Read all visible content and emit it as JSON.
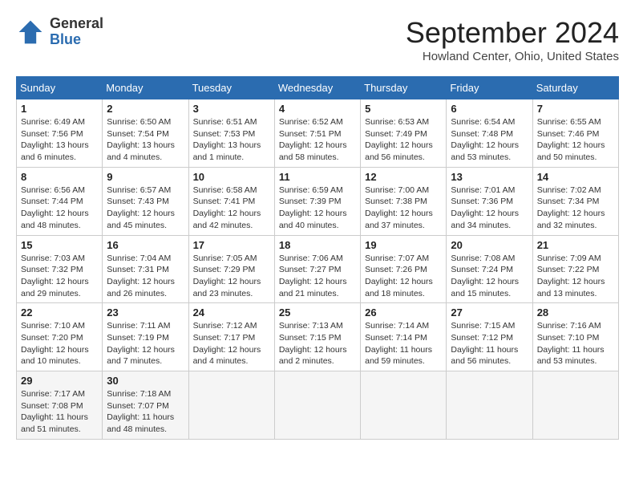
{
  "header": {
    "logo": {
      "line1": "General",
      "line2": "Blue"
    },
    "title": "September 2024",
    "location": "Howland Center, Ohio, United States"
  },
  "calendar": {
    "days_of_week": [
      "Sunday",
      "Monday",
      "Tuesday",
      "Wednesday",
      "Thursday",
      "Friday",
      "Saturday"
    ],
    "weeks": [
      [
        {
          "day": "1",
          "info": "Sunrise: 6:49 AM\nSunset: 7:56 PM\nDaylight: 13 hours\nand 6 minutes."
        },
        {
          "day": "2",
          "info": "Sunrise: 6:50 AM\nSunset: 7:54 PM\nDaylight: 13 hours\nand 4 minutes."
        },
        {
          "day": "3",
          "info": "Sunrise: 6:51 AM\nSunset: 7:53 PM\nDaylight: 13 hours\nand 1 minute."
        },
        {
          "day": "4",
          "info": "Sunrise: 6:52 AM\nSunset: 7:51 PM\nDaylight: 12 hours\nand 58 minutes."
        },
        {
          "day": "5",
          "info": "Sunrise: 6:53 AM\nSunset: 7:49 PM\nDaylight: 12 hours\nand 56 minutes."
        },
        {
          "day": "6",
          "info": "Sunrise: 6:54 AM\nSunset: 7:48 PM\nDaylight: 12 hours\nand 53 minutes."
        },
        {
          "day": "7",
          "info": "Sunrise: 6:55 AM\nSunset: 7:46 PM\nDaylight: 12 hours\nand 50 minutes."
        }
      ],
      [
        {
          "day": "8",
          "info": "Sunrise: 6:56 AM\nSunset: 7:44 PM\nDaylight: 12 hours\nand 48 minutes."
        },
        {
          "day": "9",
          "info": "Sunrise: 6:57 AM\nSunset: 7:43 PM\nDaylight: 12 hours\nand 45 minutes."
        },
        {
          "day": "10",
          "info": "Sunrise: 6:58 AM\nSunset: 7:41 PM\nDaylight: 12 hours\nand 42 minutes."
        },
        {
          "day": "11",
          "info": "Sunrise: 6:59 AM\nSunset: 7:39 PM\nDaylight: 12 hours\nand 40 minutes."
        },
        {
          "day": "12",
          "info": "Sunrise: 7:00 AM\nSunset: 7:38 PM\nDaylight: 12 hours\nand 37 minutes."
        },
        {
          "day": "13",
          "info": "Sunrise: 7:01 AM\nSunset: 7:36 PM\nDaylight: 12 hours\nand 34 minutes."
        },
        {
          "day": "14",
          "info": "Sunrise: 7:02 AM\nSunset: 7:34 PM\nDaylight: 12 hours\nand 32 minutes."
        }
      ],
      [
        {
          "day": "15",
          "info": "Sunrise: 7:03 AM\nSunset: 7:32 PM\nDaylight: 12 hours\nand 29 minutes."
        },
        {
          "day": "16",
          "info": "Sunrise: 7:04 AM\nSunset: 7:31 PM\nDaylight: 12 hours\nand 26 minutes."
        },
        {
          "day": "17",
          "info": "Sunrise: 7:05 AM\nSunset: 7:29 PM\nDaylight: 12 hours\nand 23 minutes."
        },
        {
          "day": "18",
          "info": "Sunrise: 7:06 AM\nSunset: 7:27 PM\nDaylight: 12 hours\nand 21 minutes."
        },
        {
          "day": "19",
          "info": "Sunrise: 7:07 AM\nSunset: 7:26 PM\nDaylight: 12 hours\nand 18 minutes."
        },
        {
          "day": "20",
          "info": "Sunrise: 7:08 AM\nSunset: 7:24 PM\nDaylight: 12 hours\nand 15 minutes."
        },
        {
          "day": "21",
          "info": "Sunrise: 7:09 AM\nSunset: 7:22 PM\nDaylight: 12 hours\nand 13 minutes."
        }
      ],
      [
        {
          "day": "22",
          "info": "Sunrise: 7:10 AM\nSunset: 7:20 PM\nDaylight: 12 hours\nand 10 minutes."
        },
        {
          "day": "23",
          "info": "Sunrise: 7:11 AM\nSunset: 7:19 PM\nDaylight: 12 hours\nand 7 minutes."
        },
        {
          "day": "24",
          "info": "Sunrise: 7:12 AM\nSunset: 7:17 PM\nDaylight: 12 hours\nand 4 minutes."
        },
        {
          "day": "25",
          "info": "Sunrise: 7:13 AM\nSunset: 7:15 PM\nDaylight: 12 hours\nand 2 minutes."
        },
        {
          "day": "26",
          "info": "Sunrise: 7:14 AM\nSunset: 7:14 PM\nDaylight: 11 hours\nand 59 minutes."
        },
        {
          "day": "27",
          "info": "Sunrise: 7:15 AM\nSunset: 7:12 PM\nDaylight: 11 hours\nand 56 minutes."
        },
        {
          "day": "28",
          "info": "Sunrise: 7:16 AM\nSunset: 7:10 PM\nDaylight: 11 hours\nand 53 minutes."
        }
      ],
      [
        {
          "day": "29",
          "info": "Sunrise: 7:17 AM\nSunset: 7:08 PM\nDaylight: 11 hours\nand 51 minutes."
        },
        {
          "day": "30",
          "info": "Sunrise: 7:18 AM\nSunset: 7:07 PM\nDaylight: 11 hours\nand 48 minutes."
        },
        {
          "day": "",
          "info": ""
        },
        {
          "day": "",
          "info": ""
        },
        {
          "day": "",
          "info": ""
        },
        {
          "day": "",
          "info": ""
        },
        {
          "day": "",
          "info": ""
        }
      ]
    ]
  }
}
